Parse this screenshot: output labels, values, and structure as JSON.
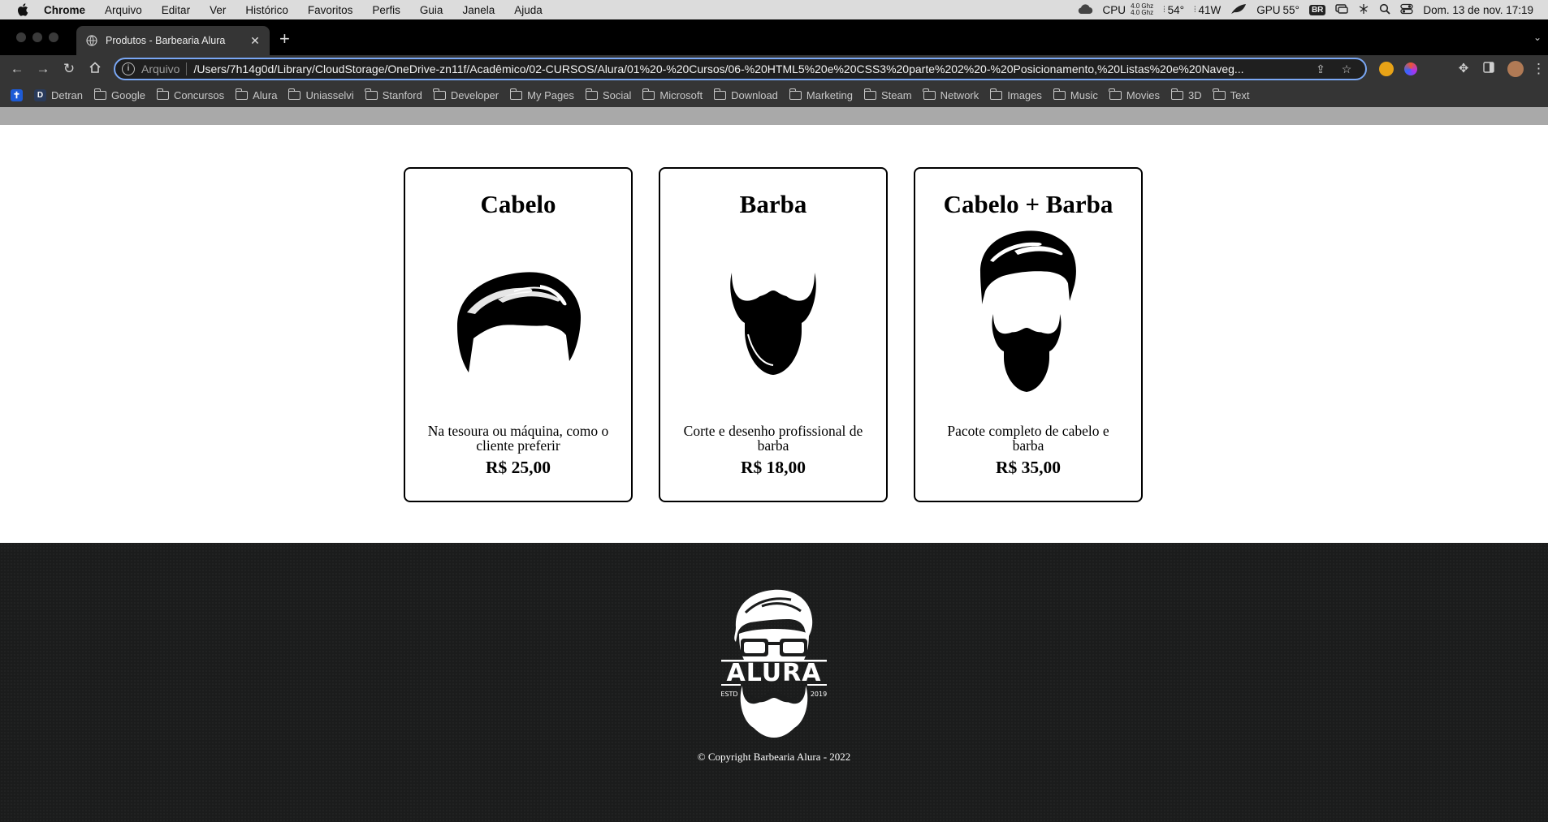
{
  "menubar": {
    "app": "Chrome",
    "items": [
      "Arquivo",
      "Editar",
      "Ver",
      "Histórico",
      "Favoritos",
      "Perfis",
      "Guia",
      "Janela",
      "Ajuda"
    ],
    "status": {
      "cpu_label": "CPU",
      "cpu_freq_top": "4.0 Ghz",
      "cpu_freq_bottom": "4.0 Ghz",
      "cpu_temp": "54°",
      "power": "41W",
      "gpu_label": "GPU",
      "gpu_temp": "55°",
      "input_source": "BR",
      "datetime": "Dom. 13 de nov.  17:19"
    }
  },
  "browser": {
    "tab_title": "Produtos - Barbearia Alura",
    "new_tab_label": "+",
    "address_scheme": "Arquivo",
    "address_url": "/Users/7h14g0d/Library/CloudStorage/OneDrive-zn11f/Acadêmico/02-CURSOS/Alura/01%20-%20Cursos/06-%20HTML5%20e%20CSS3%20parte%202%20-%20Posicionamento,%20Listas%20e%20Naveg..."
  },
  "bookmarks": [
    "Detran",
    "Google",
    "Concursos",
    "Alura",
    "Uniasselvi",
    "Stanford",
    "Developer",
    "My Pages",
    "Social",
    "Microsoft",
    "Download",
    "Marketing",
    "Steam",
    "Network",
    "Images",
    "Music",
    "Movies",
    "3D",
    "Text"
  ],
  "products": [
    {
      "title": "Cabelo",
      "description": "Na tesoura ou máquina, como o cliente preferir",
      "price": "R$ 25,00",
      "icon": "hair-icon"
    },
    {
      "title": "Barba",
      "description": "Corte e desenho profissional de barba",
      "price": "R$ 18,00",
      "icon": "beard-icon"
    },
    {
      "title": "Cabelo + Barba",
      "description": "Pacote completo de cabelo e barba",
      "price": "R$ 35,00",
      "icon": "hair-and-beard-icon"
    }
  ],
  "footer": {
    "logo_text": "ALURA",
    "logo_left": "ESTD",
    "logo_right": "2019",
    "copyright": "© Copyright Barbearia Alura - 2022"
  }
}
